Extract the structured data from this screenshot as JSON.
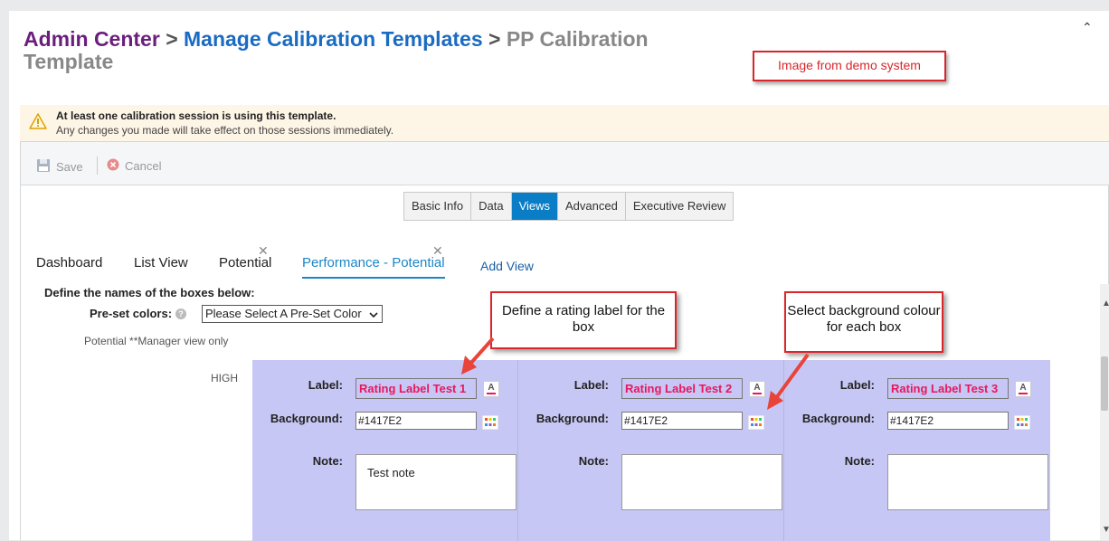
{
  "breadcrumb": {
    "admin_center": "Admin Center",
    "separator": ">",
    "manage_templates": "Manage Calibration Templates",
    "current": "PP Calibration Template"
  },
  "demo_note": "Image from demo system",
  "warning": {
    "title": "At least one calibration session is using this template.",
    "message": "Any changes you made will take effect on those sessions immediately."
  },
  "toolbar": {
    "save_label": "Save",
    "cancel_label": "Cancel"
  },
  "tabs": [
    {
      "label": "Basic Info",
      "active": false
    },
    {
      "label": "Data",
      "active": false
    },
    {
      "label": "Views",
      "active": true
    },
    {
      "label": "Advanced",
      "active": false
    },
    {
      "label": "Executive Review",
      "active": false
    }
  ],
  "view_tabs": [
    {
      "label": "Dashboard",
      "closable": false,
      "active": false
    },
    {
      "label": "List View",
      "closable": false,
      "active": false
    },
    {
      "label": "Potential",
      "closable": true,
      "active": false
    },
    {
      "label": "Performance - Potential",
      "closable": true,
      "active": true
    }
  ],
  "add_view_label": "Add View",
  "define_heading": "Define the names of the boxes below:",
  "preset": {
    "label": "Pre-set colors:",
    "selected": "Please Select A Pre-Set Color"
  },
  "potential_note": "Potential **Manager view only",
  "row_label": "HIGH",
  "field_labels": {
    "label": "Label:",
    "background": "Background:",
    "note": "Note:"
  },
  "boxes": [
    {
      "label": "Rating Label Test 1",
      "background": "#1417E2",
      "note": "Test note"
    },
    {
      "label": "Rating Label Test 2",
      "background": "#1417E2",
      "note": ""
    },
    {
      "label": "Rating Label Test 3",
      "background": "#1417E2",
      "note": ""
    }
  ],
  "callouts": {
    "rating_label": "Define a rating label for the box",
    "background": "Select background colour for each box"
  },
  "colors": {
    "accent": "#0a7dc7",
    "callout_border": "#d9262b",
    "grid_bg": "#c7c7f5",
    "label_text": "#e8175d"
  }
}
